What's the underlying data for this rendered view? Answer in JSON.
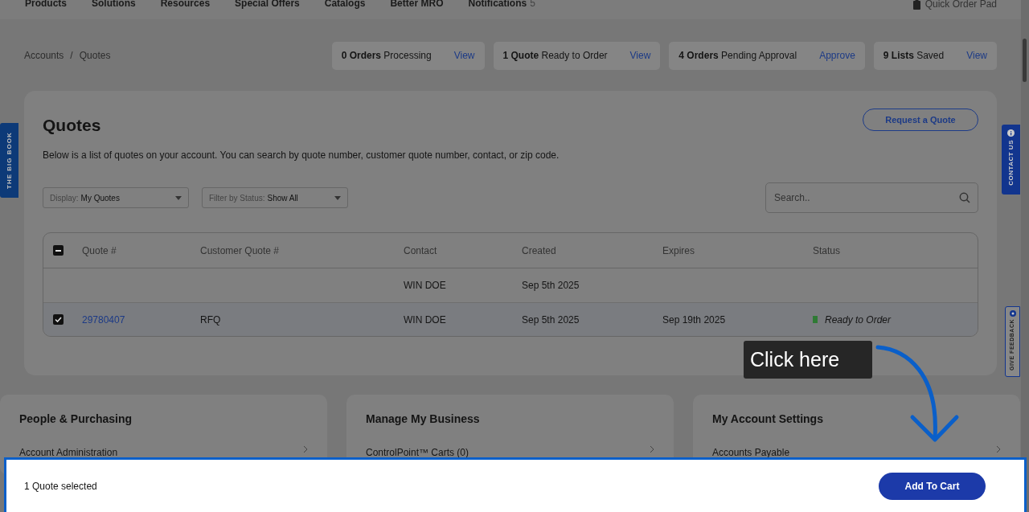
{
  "nav": {
    "items": [
      {
        "label": "Products"
      },
      {
        "label": "Solutions"
      },
      {
        "label": "Resources"
      },
      {
        "label": "Special Offers"
      },
      {
        "label": "Catalogs"
      },
      {
        "label": "Better MRO"
      },
      {
        "label": "Notifications",
        "count": "5"
      }
    ],
    "quick_order": "Quick Order Pad"
  },
  "breadcrumb": {
    "items": [
      "Accounts",
      "Quotes"
    ],
    "separator": "/"
  },
  "summary": [
    {
      "count": "0 Orders",
      "label": "Processing",
      "action": "View"
    },
    {
      "count": "1 Quote",
      "label": "Ready to Order",
      "action": "View"
    },
    {
      "count": "4 Orders",
      "label": "Pending Approval",
      "action": "Approve"
    },
    {
      "count": "9 Lists",
      "label": "Saved",
      "action": "View"
    }
  ],
  "side_tabs": {
    "left": "THE BIG BOOK",
    "contact": "CONTACT US",
    "feedback": "GIVE FEEDBACK"
  },
  "quotes": {
    "title": "Quotes",
    "request_button": "Request a Quote",
    "description": "Below is a list of quotes on your account. You can search by quote number, customer quote number, contact, or zip code.",
    "filters": [
      {
        "label": "Display:",
        "value": "My Quotes"
      },
      {
        "label": "Filter by Status:",
        "value": "Show All"
      }
    ],
    "search": {
      "placeholder": "Search.."
    },
    "select_all": {
      "indeterminate": true
    },
    "columns": [
      "Quote #",
      "Customer Quote #",
      "Contact",
      "Created",
      "Expires",
      "Status"
    ],
    "rows": [
      {
        "kind": "plain",
        "cells": [
          "",
          "",
          "WIN DOE",
          "Sep 5th 2025",
          "",
          ""
        ]
      },
      {
        "kind": "selectable",
        "selected": true,
        "cells": [
          "29780407",
          "RFQ",
          "WIN DOE",
          "Sep 5th 2025",
          "Sep 19th 2025",
          "Ready to Order"
        ],
        "color": "#2f7a35"
      }
    ]
  },
  "panels": [
    {
      "title": "People & Purchasing",
      "link": "Account Administration"
    },
    {
      "title": "Manage My Business",
      "link": "ControlPoint™ Carts (0)"
    },
    {
      "title": "My Account Settings",
      "link": "Accounts Payable"
    }
  ],
  "selection_bar": {
    "text": "1 Quote selected",
    "button": "Add To Cart"
  },
  "callout": {
    "text": "Click here"
  }
}
